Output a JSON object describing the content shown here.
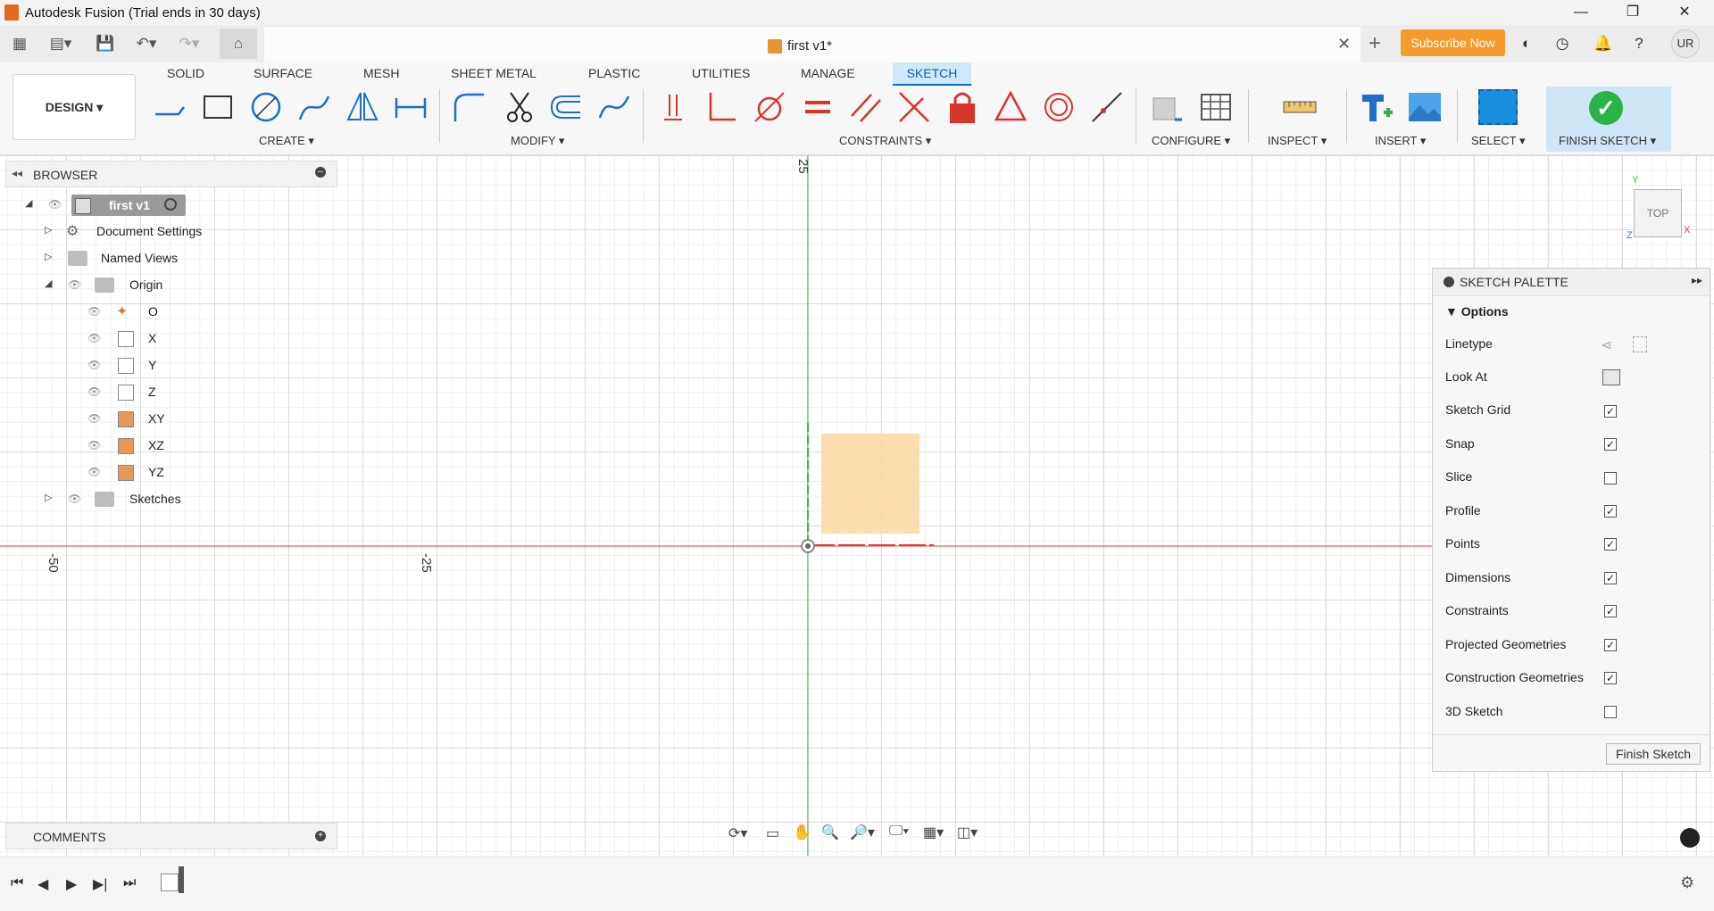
{
  "window": {
    "title": "Autodesk Fusion (Trial ends in 30 days)"
  },
  "document": {
    "tab_title": "first v1*"
  },
  "header": {
    "subscribe_label": "Subscribe Now",
    "user_initials": "UR"
  },
  "toolbar": {
    "workspace": "DESIGN ▾",
    "tabs": [
      "SOLID",
      "SURFACE",
      "MESH",
      "SHEET METAL",
      "PLASTIC",
      "UTILITIES",
      "MANAGE",
      "SKETCH"
    ],
    "active_tab": "SKETCH",
    "groups": {
      "create": "CREATE ▾",
      "modify": "MODIFY ▾",
      "constraints": "CONSTRAINTS ▾",
      "configure": "CONFIGURE ▾",
      "inspect": "INSPECT ▾",
      "insert": "INSERT ▾",
      "select": "SELECT ▾",
      "finish_sketch": "FINISH SKETCH ▾"
    }
  },
  "browser": {
    "title": "BROWSER",
    "root": "first v1",
    "items": {
      "document_settings": "Document Settings",
      "named_views": "Named Views",
      "origin": "Origin",
      "o": "O",
      "x": "X",
      "y": "Y",
      "z": "Z",
      "xy": "XY",
      "xz": "XZ",
      "yz": "YZ",
      "sketches": "Sketches"
    }
  },
  "canvas": {
    "ruler_labels": [
      "25",
      "-50",
      "-25"
    ],
    "viewcube_label": "TOP",
    "axis_labels": {
      "x": "X",
      "y": "Y",
      "z": "Z"
    }
  },
  "palette": {
    "title": "SKETCH PALETTE",
    "section": "Options",
    "rows": [
      {
        "label": "Linetype",
        "type": "icon"
      },
      {
        "label": "Look At",
        "type": "icon"
      },
      {
        "label": "Sketch Grid",
        "checked": true
      },
      {
        "label": "Snap",
        "checked": true
      },
      {
        "label": "Slice",
        "checked": false
      },
      {
        "label": "Profile",
        "checked": true
      },
      {
        "label": "Points",
        "checked": true
      },
      {
        "label": "Dimensions",
        "checked": true
      },
      {
        "label": "Constraints",
        "checked": true
      },
      {
        "label": "Projected Geometries",
        "checked": true
      },
      {
        "label": "Construction Geometries",
        "checked": true
      },
      {
        "label": "3D Sketch",
        "checked": false
      }
    ],
    "finish_button": "Finish Sketch"
  },
  "comments": {
    "title": "COMMENTS"
  },
  "colors": {
    "accent": "#0a6ed1",
    "subscribe": "#f39b2b",
    "finish": "#2bb34a",
    "x_axis": "#e03b3b",
    "y_axis": "#3dbb3d",
    "profile": "#fcd9a5"
  }
}
